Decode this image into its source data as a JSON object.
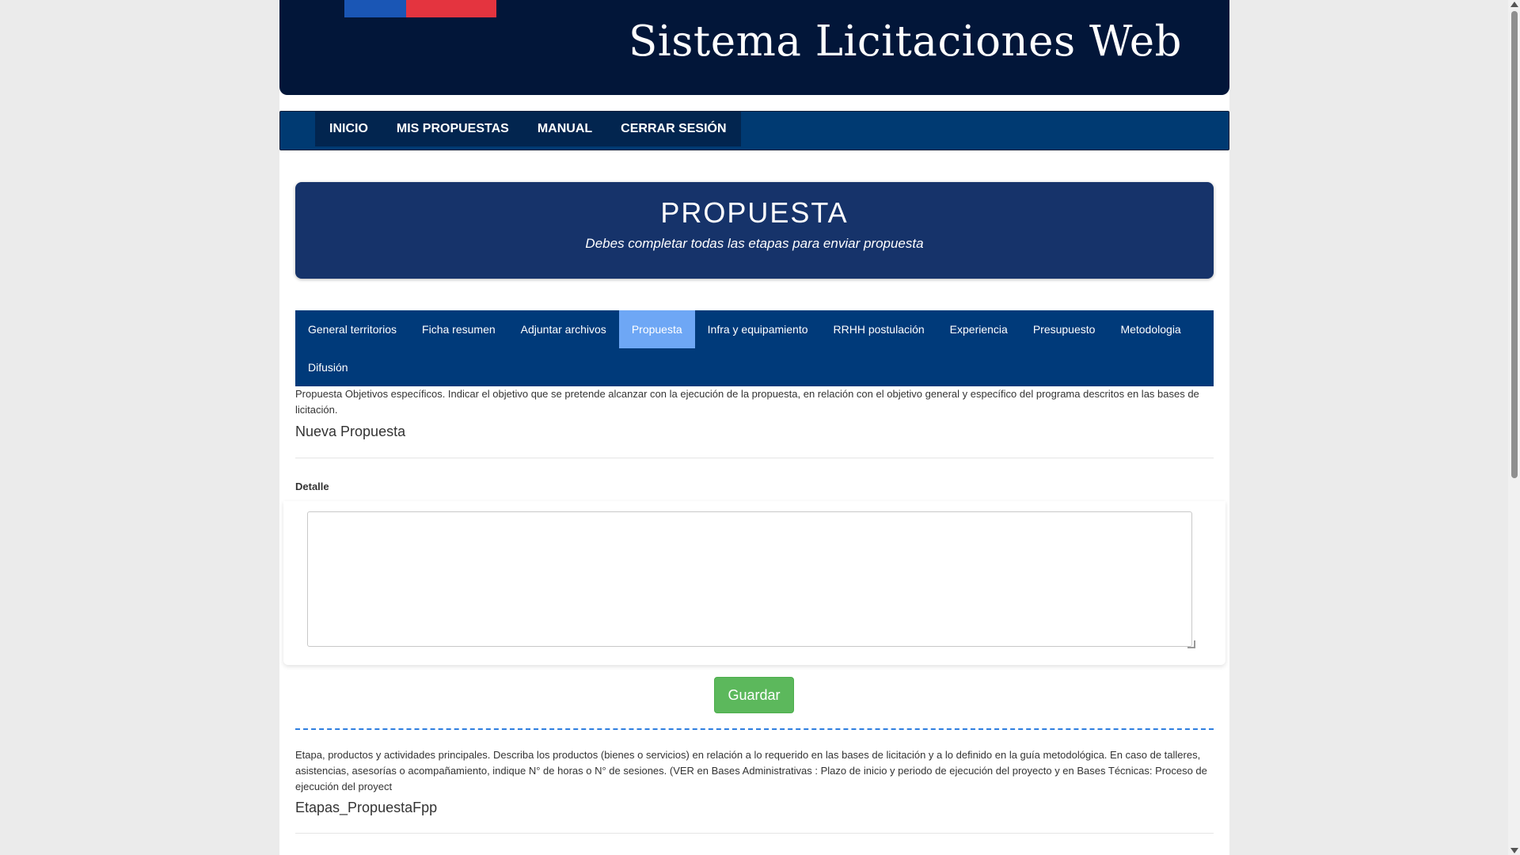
{
  "header": {
    "site_title": "Sistema Licitaciones Web"
  },
  "nav": {
    "items": [
      "INICIO",
      "MIS PROPUESTAS",
      "MANUAL",
      "CERRAR SESIÓN"
    ]
  },
  "hero": {
    "title": "PROPUESTA",
    "subtitle": "Debes completar todas las etapas para enviar propuesta"
  },
  "tabs": {
    "row1": [
      "General territorios",
      "Ficha resumen",
      "Adjuntar archivos",
      "Propuesta",
      "Infra y equipamiento",
      "RRHH postulación",
      "Experiencia",
      "Presupuesto",
      "Metodologia"
    ],
    "row2": [
      "Difusión"
    ],
    "active": "Propuesta"
  },
  "section1": {
    "description": "Propuesta Objetivos específicos. Indicar el objetivo que se pretende alcanzar con la ejecución de la propuesta, en relación con el objetivo general y específico del programa descritos en las bases de licitación.",
    "title": "Nueva Propuesta",
    "detail_label": "Detalle",
    "detail_value": "",
    "save_label": "Guardar"
  },
  "section2": {
    "description": "Etapa, productos y actividades principales. Describa los productos (bienes o servicios) en relación a lo requerido en las bases de licitación y a lo definido en la guía metodológica. En caso de talleres, asistencias, asesorías o acompañamiento, indique N° de horas o N° de sesiones. (VER en Bases Administrativas : Plazo de inicio y periodo de ejecución del proyecto y en Bases Técnicas: Proceso de ejecución del proyect",
    "title": "Etapas_PropuestaFpp"
  },
  "colors": {
    "banner": "#021639",
    "nav": "#003a72",
    "hero": "#16336a",
    "tab_bar": "#003a7a",
    "tab_active": "#6ea7f5",
    "save_button": "#5cb85c",
    "divider": "#2f7fe0"
  }
}
